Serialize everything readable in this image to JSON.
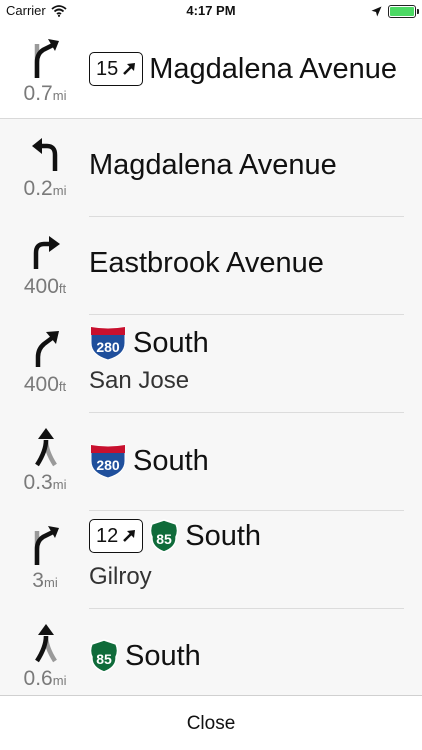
{
  "status": {
    "carrier": "Carrier",
    "time": "4:17 PM",
    "battery_level": 1.0
  },
  "steps": [
    {
      "maneuver": "bear-right",
      "distance": "0.7",
      "unit": "mi",
      "route_number": "15",
      "road": "Magdalena Avenue"
    },
    {
      "maneuver": "turn-left",
      "distance": "0.2",
      "unit": "mi",
      "road": "Magdalena Avenue"
    },
    {
      "maneuver": "turn-right",
      "distance": "400",
      "unit": "ft",
      "road": "Eastbrook Avenue"
    },
    {
      "maneuver": "slight-right",
      "distance": "400",
      "unit": "ft",
      "shield": "280",
      "road": "South",
      "subtitle": "San Jose"
    },
    {
      "maneuver": "keep-left",
      "distance": "0.3",
      "unit": "mi",
      "shield": "280",
      "road": "South"
    },
    {
      "maneuver": "bear-right",
      "distance": "3",
      "unit": "mi",
      "route_number": "12",
      "shield": "85",
      "road": "South",
      "subtitle": "Gilroy"
    },
    {
      "maneuver": "keep-left",
      "distance": "0.6",
      "unit": "mi",
      "shield": "85",
      "road": "South"
    }
  ],
  "footer": {
    "close_label": "Close"
  },
  "colors": {
    "interstate_blue": "#1f4f9c",
    "interstate_red": "#c8102e",
    "state_green": "#0f6b3a",
    "battery_green": "#4cd964"
  }
}
